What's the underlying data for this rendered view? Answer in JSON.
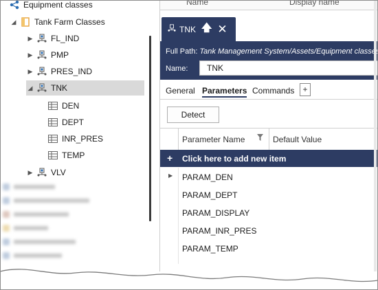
{
  "tree": {
    "root_label": "Equipment classes",
    "group_label": "Tank Farm Classes",
    "items": [
      {
        "label": "FL_IND",
        "expanded": false
      },
      {
        "label": "PMP",
        "expanded": false
      },
      {
        "label": "PRES_IND",
        "expanded": false
      },
      {
        "label": "TNK",
        "expanded": true,
        "selected": true
      },
      {
        "label": "DEN"
      },
      {
        "label": "DEPT"
      },
      {
        "label": "INR_PRES"
      },
      {
        "label": "TEMP"
      },
      {
        "label": "VLV",
        "expanded": false
      }
    ]
  },
  "top_columns": {
    "name": "Name",
    "display_name": "Display name"
  },
  "doc_tab": {
    "title": "TNK"
  },
  "header": {
    "full_path_label": "Full Path:",
    "full_path_value": "Tank Management System/Assets/Equipment classes",
    "name_label": "Name:",
    "name_value": "TNK"
  },
  "subtabs": [
    "General",
    "Parameters",
    "Commands"
  ],
  "subtab_add": "+",
  "detect_button": "Detect",
  "grid": {
    "col_param": "Parameter Name",
    "col_default": "Default Value",
    "add_row_icon": "+",
    "add_row_text": "Click here to add new item",
    "rows": [
      "PARAM_DEN",
      "PARAM_DEPT",
      "PARAM_DISPLAY",
      "PARAM_INR_PRES",
      "PARAM_TEMP"
    ]
  },
  "colors": {
    "header_bg": "#2d3c63",
    "selection": "#d9d9d9",
    "accent_icon": "#2b6cb0",
    "folder": "#e8a33c"
  }
}
